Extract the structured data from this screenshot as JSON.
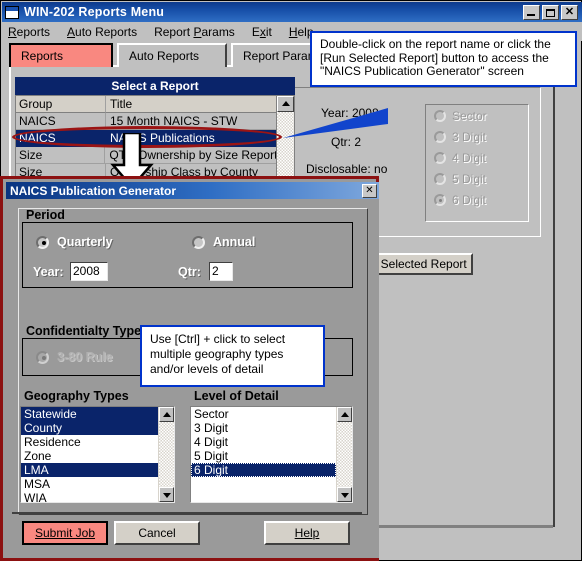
{
  "window": {
    "title": "WIN-202 Reports Menu",
    "icon": "app-window-icon",
    "buttons": {
      "minimize": "minimize-icon",
      "maximize": "maximize-icon",
      "close": "✕"
    }
  },
  "menubar": {
    "items": [
      {
        "label": "Reports",
        "accel": "R"
      },
      {
        "label": "Auto Reports",
        "accel": "A"
      },
      {
        "label": "Report Params",
        "accel": "P"
      },
      {
        "label": "Exit",
        "accel": "x"
      },
      {
        "label": "Help",
        "accel": "H"
      }
    ]
  },
  "tabs": [
    {
      "label": "Reports",
      "active": true
    },
    {
      "label": "Auto Reports",
      "active": false
    },
    {
      "label": "Report Params",
      "active": false
    }
  ],
  "report_list": {
    "header": "Select a Report",
    "columns": [
      "Group",
      "Title"
    ],
    "rows": [
      {
        "group": "NAICS",
        "title": "15 Month NAICS - STW",
        "selected": false
      },
      {
        "group": "NAICS",
        "title": "NAICS Publications",
        "selected": true
      },
      {
        "group": "Size",
        "title": "QTR Ownership by Size Report",
        "selected": false
      },
      {
        "group": "Size",
        "title": "Ownership Class by County",
        "selected": false
      }
    ],
    "scroll": {
      "up": "scroll-up-arrow",
      "down": "scroll-down-arrow"
    }
  },
  "background_form": {
    "year_label": "Year:",
    "year_value": "2008",
    "qtr_label": "Qtr:",
    "qtr_value": "2",
    "disclosable_label": "Disclosable:",
    "disclosable_value": "no",
    "detail_options": [
      {
        "label": "Sector",
        "selected": false
      },
      {
        "label": "3 Digit",
        "selected": false
      },
      {
        "label": "4 Digit",
        "selected": false
      },
      {
        "label": "5 Digit",
        "selected": false
      },
      {
        "label": "6 Digit",
        "selected": true
      }
    ],
    "run_button": "Run Selected Report"
  },
  "callouts": [
    {
      "id": "callout-report-name",
      "text": "Double-click on the report name or click the [Run Selected Report] button to access the \"NAICS Publication Generator\" screen",
      "border_color": "#0033cc"
    },
    {
      "id": "callout-multiselect",
      "text": "Use [Ctrl] + click to select multiple geography types and/or levels of detail",
      "border_color": "#0033cc"
    }
  ],
  "annotations": {
    "ellipse_color": "#9b1414",
    "arrow": "down-arrow"
  },
  "dialog": {
    "title": "NAICS Publication Generator",
    "close_label": "✕",
    "frame_color": "#8c1111",
    "period": {
      "group_label": "Period",
      "options": [
        {
          "label": "Quarterly",
          "selected": true
        },
        {
          "label": "Annual",
          "selected": false
        }
      ],
      "year_label": "Year:",
      "year_value": "2008",
      "qtr_label": "Qtr:",
      "qtr_value": "2"
    },
    "confidentiality": {
      "group_label": "Confidentialty Type",
      "options": [
        {
          "label": "3-80 Rule",
          "selected": true,
          "disabled": true
        }
      ]
    },
    "geography": {
      "label": "Geography Types",
      "items": [
        {
          "label": "Statewide",
          "selected": true
        },
        {
          "label": "County",
          "selected": true
        },
        {
          "label": "Residence",
          "selected": false
        },
        {
          "label": "Zone",
          "selected": false
        },
        {
          "label": "LMA",
          "selected": true
        },
        {
          "label": "MSA",
          "selected": false
        },
        {
          "label": "WIA",
          "selected": false
        }
      ]
    },
    "level_of_detail": {
      "label": "Level of Detail",
      "items": [
        {
          "label": "Sector",
          "selected": false
        },
        {
          "label": "3 Digit",
          "selected": false
        },
        {
          "label": "4 Digit",
          "selected": false
        },
        {
          "label": "5 Digit",
          "selected": false
        },
        {
          "label": "6 Digit",
          "selected": true,
          "focused": true
        }
      ]
    },
    "buttons": {
      "submit": "Submit Job",
      "submit_accel": "S",
      "cancel": "Cancel",
      "help": "Help",
      "help_accel": "H",
      "submit_color": "#f98880"
    }
  }
}
